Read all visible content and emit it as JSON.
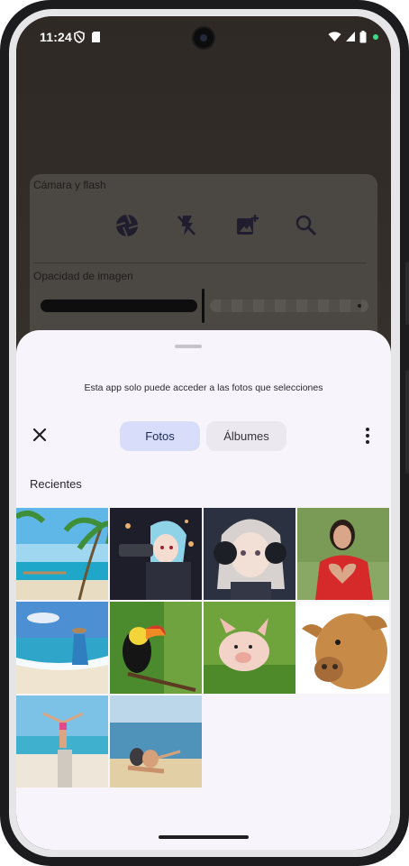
{
  "status_bar": {
    "time": "11:24"
  },
  "background_app": {
    "camera_section_label": "Cámara y flash",
    "opacity_section_label": "Opacidad de imagen"
  },
  "picker": {
    "info_text": "Esta app solo puede acceder a las fotos que selecciones",
    "tabs": [
      {
        "label": "Fotos",
        "selected": true
      },
      {
        "label": "Álbumes",
        "selected": false
      }
    ],
    "section_title": "Recientes",
    "photos": [
      {
        "subject": "tropical beach with palm trees"
      },
      {
        "subject": "anime girl with gun"
      },
      {
        "subject": "anime girl with headphones"
      },
      {
        "subject": "woman making heart shape"
      },
      {
        "subject": "woman in blue dress on beach"
      },
      {
        "subject": "toucan on branch"
      },
      {
        "subject": "piglet in grass"
      },
      {
        "subject": "calf"
      },
      {
        "subject": "woman on rocks at beach"
      },
      {
        "subject": "couple sitting on beach"
      }
    ]
  },
  "colors": {
    "sheet_background": "#f7f5fb",
    "selected_tab": "#d8def9",
    "unselected_tab": "#ebe8f0"
  }
}
